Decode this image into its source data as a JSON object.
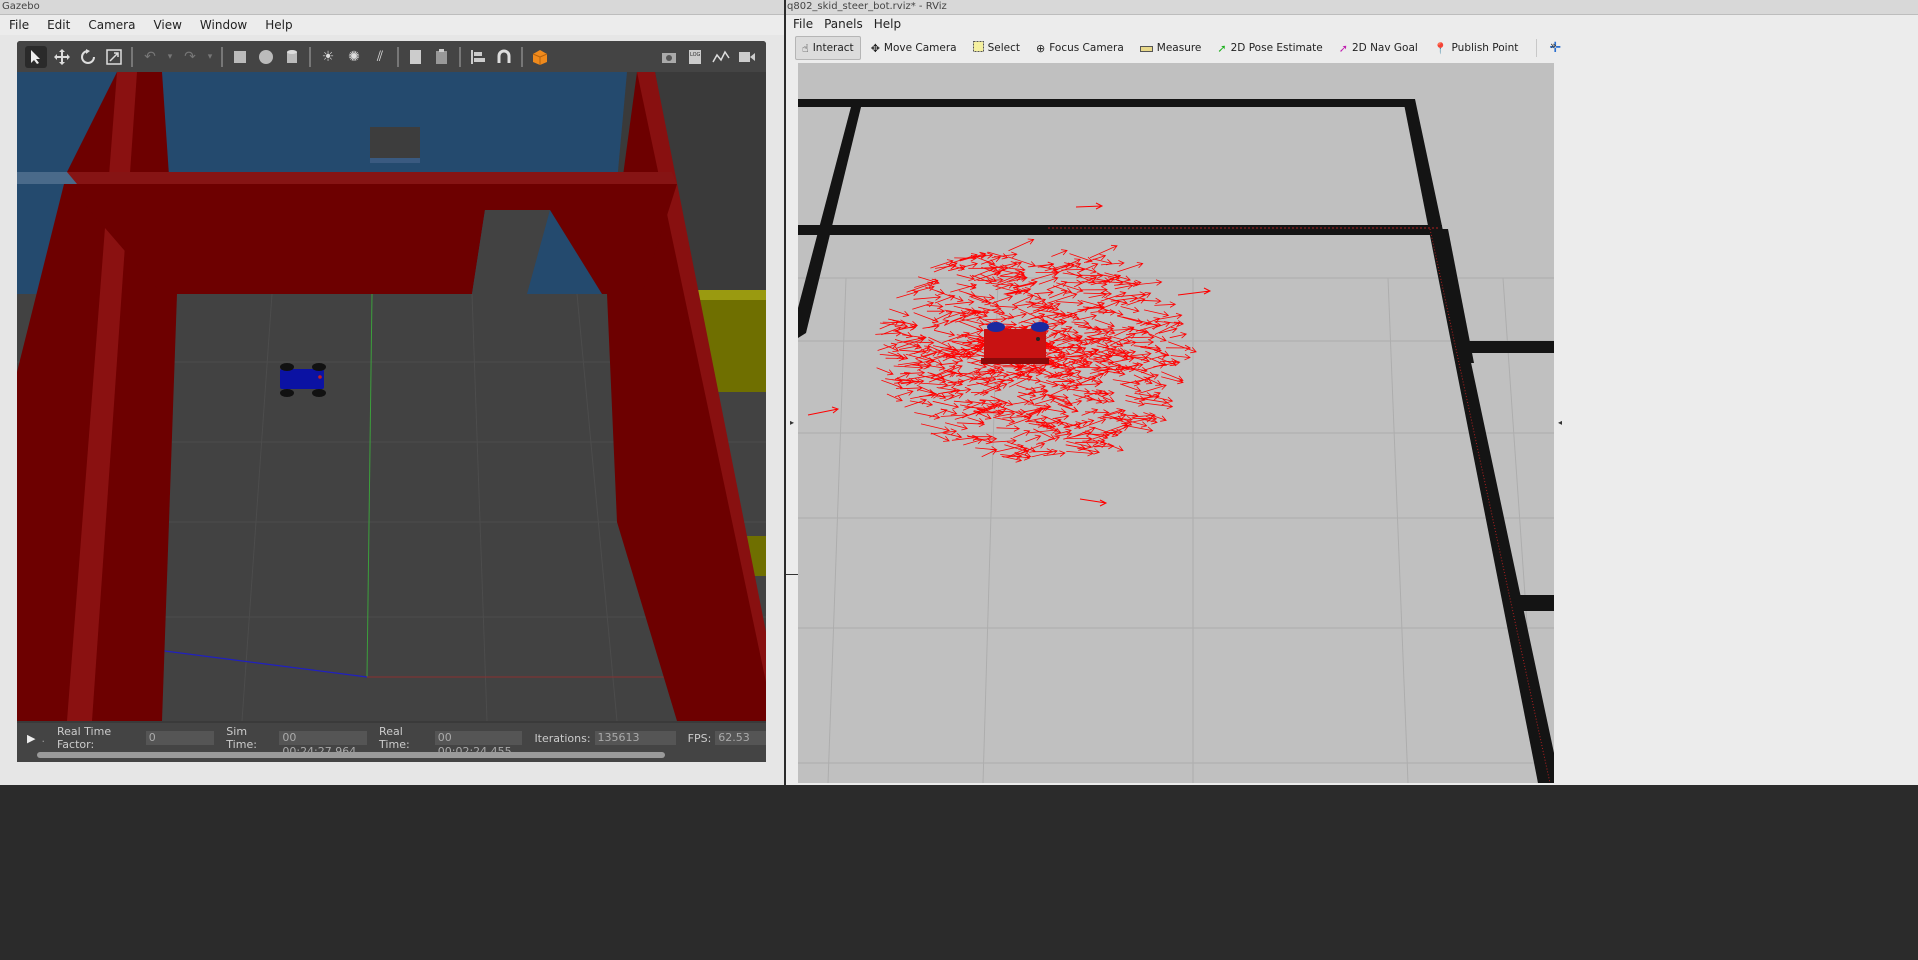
{
  "gazebo": {
    "window_title": "Gazebo",
    "menu": [
      "File",
      "Edit",
      "Camera",
      "View",
      "Window",
      "Help"
    ],
    "toolbar_icons": [
      "select-arrow-icon",
      "translate-icon",
      "rotate-icon",
      "scale-icon",
      "undo-icon",
      "undo-menu-icon",
      "redo-icon",
      "redo-menu-icon",
      "box-icon",
      "sphere-icon",
      "cylinder-icon",
      "point-light-icon",
      "spot-light-icon",
      "directional-light-icon",
      "copy-icon",
      "paste-icon",
      "align-icon",
      "snap-icon",
      "view-angle-icon",
      "screenshot-icon",
      "log-icon",
      "plot-icon",
      "video-icon"
    ],
    "status": {
      "rtf_label": "Real Time Factor:",
      "rtf_value": "0",
      "sim_label": "Sim Time:",
      "sim_value": "00 00:24:27.964",
      "real_label": "Real Time:",
      "real_value": "00 00:02:24.455",
      "iter_label": "Iterations:",
      "iter_value": "135613",
      "fps_label": "FPS:",
      "fps_value": "62.53"
    }
  },
  "rviz": {
    "window_title": "q802_skid_steer_bot.rviz* - RViz",
    "menu": [
      "File",
      "Panels",
      "Help"
    ],
    "tools": [
      {
        "label": "Interact",
        "icon": "hand-icon"
      },
      {
        "label": "Move Camera",
        "icon": "move-camera-icon"
      },
      {
        "label": "Select",
        "icon": "select-box-icon"
      },
      {
        "label": "Focus Camera",
        "icon": "focus-icon"
      },
      {
        "label": "Measure",
        "icon": "ruler-icon"
      },
      {
        "label": "2D Pose Estimate",
        "icon": "pose-arrow-green-icon"
      },
      {
        "label": "2D Nav Goal",
        "icon": "goal-arrow-pink-icon"
      },
      {
        "label": "Publish Point",
        "icon": "map-pin-icon"
      }
    ],
    "add_tool_icon": "plus-icon",
    "more_icon": "chevron-double-right-icon"
  },
  "colors": {
    "wall_red": "#6d0000",
    "sky_blue": "#244a6e",
    "floor": "#404040",
    "robot_blue": "#0b12a3",
    "arrows": "#ff0000",
    "map_bg": "#c0c0c0"
  }
}
